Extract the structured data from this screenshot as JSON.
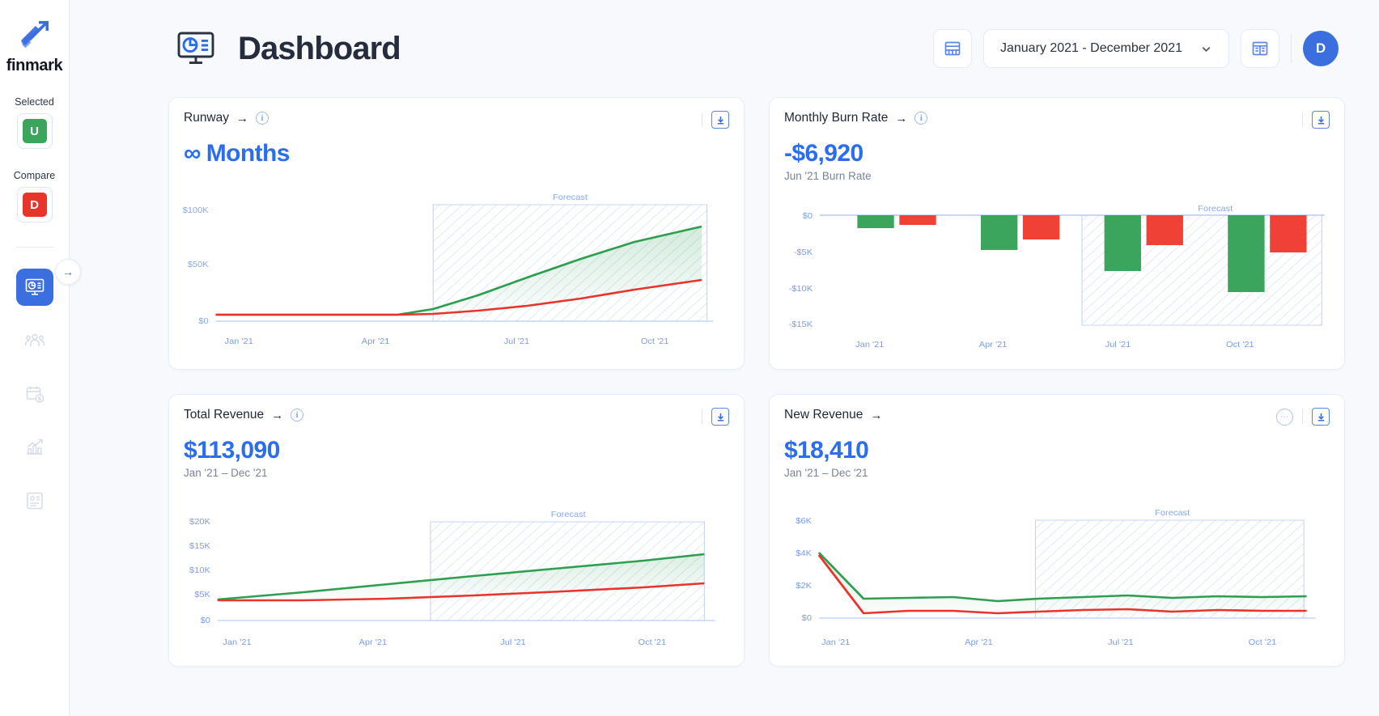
{
  "brand": {
    "name": "finmark",
    "logo_icon": "finmark-arrow-logo"
  },
  "sidebar": {
    "selected_label": "Selected",
    "selected_chip": {
      "letter": "U",
      "color": "#3ba55d"
    },
    "compare_label": "Compare",
    "compare_chip": {
      "letter": "D",
      "color": "#e8342a"
    },
    "expand_icon": "arrow-right-icon",
    "nav": [
      {
        "name": "dashboard",
        "icon": "dashboard-monitor-icon",
        "active": true
      },
      {
        "name": "headcount",
        "icon": "people-group-icon",
        "active": false
      },
      {
        "name": "expenses",
        "icon": "calendar-dollar-icon",
        "active": false
      },
      {
        "name": "reports",
        "icon": "bar-chart-trend-icon",
        "active": false
      },
      {
        "name": "documents",
        "icon": "document-icon",
        "active": false
      }
    ]
  },
  "header": {
    "title": "Dashboard",
    "title_icon": "dashboard-monitor-icon",
    "grid_view_icon": "table-rows-icon",
    "date_range": "January 2021 - December 2021",
    "chevron_icon": "chevron-down-icon",
    "columns_view_icon": "table-columns-icon",
    "avatar_letter": "D"
  },
  "cards": [
    {
      "id": "runway",
      "title": "Runway",
      "arrow": "→",
      "info_icon": "info-icon",
      "has_info": true,
      "has_dots": false,
      "download_icon": "download-icon",
      "kpi_symbol": "∞",
      "kpi": "Months",
      "kpi_sub": ""
    },
    {
      "id": "monthly-burn-rate",
      "title": "Monthly Burn Rate",
      "arrow": "→",
      "info_icon": "info-icon",
      "has_info": true,
      "has_dots": false,
      "download_icon": "download-icon",
      "kpi_symbol": "",
      "kpi": "-$6,920",
      "kpi_sub": "Jun '21 Burn Rate"
    },
    {
      "id": "total-revenue",
      "title": "Total Revenue",
      "arrow": "→",
      "info_icon": "info-icon",
      "has_info": true,
      "has_dots": false,
      "download_icon": "download-icon",
      "kpi_symbol": "",
      "kpi": "$113,090",
      "kpi_sub": "Jan '21 – Dec '21"
    },
    {
      "id": "new-revenue",
      "title": "New Revenue",
      "arrow": "→",
      "info_icon": "",
      "has_info": false,
      "has_dots": true,
      "dots_icon": "more-options-icon",
      "download_icon": "download-icon",
      "kpi_symbol": "",
      "kpi": "$18,410",
      "kpi_sub": "Jan '21 – Dec '21"
    }
  ],
  "colors": {
    "accent": "#2a6df0",
    "selected_series": "#3ba55d",
    "compare_series": "#e8342a",
    "axis_text": "#7b9ced",
    "forecast_band": "#adc3f2",
    "page_bg": "#f7f9fc"
  },
  "chart_data": [
    {
      "id": "runway",
      "type": "line",
      "title": "Runway",
      "xlabel": "",
      "ylabel": "",
      "ylim": [
        0,
        125000
      ],
      "yticks": [
        0,
        50000,
        100000
      ],
      "ytick_labels": [
        "$0",
        "$50K",
        "$100K"
      ],
      "x": [
        "Jan '21",
        "Feb '21",
        "Mar '21",
        "Apr '21",
        "May '21",
        "Jun '21",
        "Jul '21",
        "Aug '21",
        "Sep '21",
        "Oct '21",
        "Nov '21",
        "Dec '21"
      ],
      "xtick_labels": [
        "Jan '21",
        "Apr '21",
        "Jul '21",
        "Oct '21"
      ],
      "forecast_label": "Forecast",
      "forecast_start_index": 6,
      "series": [
        {
          "name": "Selected",
          "color": "#2f9e4f",
          "values": [
            5000,
            5000,
            5000,
            5000,
            5200,
            6500,
            15000,
            26000,
            38000,
            50000,
            62000,
            76000
          ]
        },
        {
          "name": "Compare",
          "color": "#e8342a",
          "values": [
            5000,
            5000,
            5000,
            5000,
            5100,
            5400,
            9000,
            13500,
            19000,
            25000,
            31000,
            38000
          ]
        }
      ]
    },
    {
      "id": "monthly-burn-rate",
      "type": "bar",
      "title": "Monthly Burn Rate",
      "xlabel": "",
      "ylabel": "",
      "ylim": [
        -15500,
        1500
      ],
      "yticks": [
        0,
        -5000,
        -10000,
        -15000
      ],
      "ytick_labels": [
        "$0",
        "-$5K",
        "-$10K",
        "-$15K"
      ],
      "categories": [
        "Jan '21",
        "Apr '21",
        "Jul '21",
        "Oct '21"
      ],
      "xtick_labels": [
        "Jan '21",
        "Apr '21",
        "Jul '21",
        "Oct '21"
      ],
      "forecast_label": "Forecast",
      "forecast_start_index": 2,
      "series": [
        {
          "name": "Selected",
          "color": "#3ba55d",
          "values": [
            -1700,
            -4800,
            -7750,
            -10600
          ]
        },
        {
          "name": "Compare",
          "color": "#ef4136",
          "values": [
            -1350,
            -3350,
            -4100,
            -5150
          ]
        }
      ]
    },
    {
      "id": "total-revenue",
      "type": "line",
      "title": "Total Revenue",
      "xlabel": "",
      "ylabel": "",
      "ylim": [
        0,
        21500
      ],
      "yticks": [
        0,
        5000,
        10000,
        15000,
        20000
      ],
      "ytick_labels": [
        "$0",
        "$5K",
        "$10K",
        "$15K",
        "$20K"
      ],
      "x": [
        "Jan '21",
        "Feb '21",
        "Mar '21",
        "Apr '21",
        "May '21",
        "Jun '21",
        "Jul '21",
        "Aug '21",
        "Sep '21",
        "Oct '21",
        "Nov '21",
        "Dec '21"
      ],
      "xtick_labels": [
        "Jan '21",
        "Apr '21",
        "Jul '21",
        "Oct '21"
      ],
      "forecast_label": "Forecast",
      "forecast_start_index": 6,
      "series": [
        {
          "name": "Selected",
          "color": "#2f9e4f",
          "values": [
            4350,
            5100,
            5950,
            6750,
            7600,
            8450,
            9300,
            10150,
            11000,
            11850,
            12700,
            13500
          ]
        },
        {
          "name": "Compare",
          "color": "#e8342a",
          "values": [
            4200,
            4350,
            4500,
            4700,
            4900,
            5050,
            5300,
            5600,
            5900,
            6250,
            6700,
            7100
          ]
        }
      ]
    },
    {
      "id": "new-revenue",
      "type": "line",
      "title": "New Revenue",
      "xlabel": "",
      "ylabel": "",
      "ylim": [
        0,
        6600
      ],
      "yticks": [
        0,
        2000,
        4000,
        6000
      ],
      "ytick_labels": [
        "$0",
        "$2K",
        "$4K",
        "$6K"
      ],
      "x": [
        "Jan '21",
        "Feb '21",
        "Mar '21",
        "Apr '21",
        "May '21",
        "Jun '21",
        "Jul '21",
        "Aug '21",
        "Sep '21",
        "Oct '21",
        "Nov '21",
        "Dec '21"
      ],
      "xtick_labels": [
        "Jan '21",
        "Apr '21",
        "Jul '21",
        "Oct '21"
      ],
      "forecast_label": "Forecast",
      "forecast_start_index": 6,
      "series": [
        {
          "name": "Selected",
          "color": "#2f9e4f",
          "values": [
            4050,
            1200,
            1230,
            1290,
            1050,
            1180,
            1290,
            1370,
            1250,
            1320,
            1300,
            1340
          ]
        },
        {
          "name": "Compare",
          "color": "#e8342a",
          "values": [
            3880,
            420,
            530,
            470,
            370,
            450,
            560,
            640,
            500,
            600,
            520,
            540
          ]
        }
      ]
    }
  ]
}
